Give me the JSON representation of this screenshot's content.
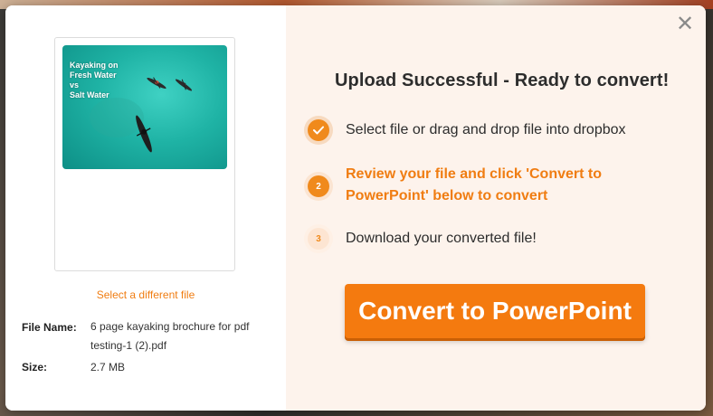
{
  "preview": {
    "thumbnail_title": "Kayaking on\nFresh Water\nvs\nSalt Water"
  },
  "left": {
    "select_link": "Select a different file",
    "file_name_label": "File Name:",
    "file_name_value": "6 page kayaking brochure for pdf testing-1 (2).pdf",
    "size_label": "Size:",
    "size_value": "2.7 MB"
  },
  "right": {
    "heading": "Upload Successful - Ready to convert!",
    "steps": [
      {
        "icon": "check-icon",
        "number": "",
        "label": "Select file or drag and drop file into dropbox",
        "state": "done"
      },
      {
        "icon": "",
        "number": "2",
        "label": "Review your file and click 'Convert to PowerPoint' below to convert",
        "state": "active"
      },
      {
        "icon": "",
        "number": "3",
        "label": "Download your converted file!",
        "state": "pending"
      }
    ],
    "convert_button": "Convert to PowerPoint"
  },
  "close_icon": "close-icon",
  "colors": {
    "accent": "#f47a0f",
    "panel_bg": "#fdf3ec",
    "text": "#2d2d2d"
  }
}
